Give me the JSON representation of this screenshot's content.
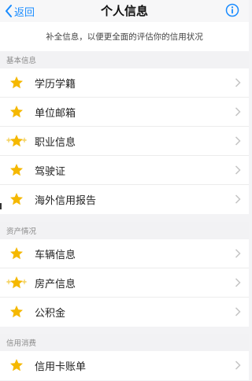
{
  "nav": {
    "back_label": "返回",
    "title": "个人信息",
    "info_icon": "info-circle-icon"
  },
  "notice": "补全信息，以便更全面的评估你的信用状况",
  "sections": [
    {
      "header": "基本信息",
      "items": [
        {
          "label": "学历学籍",
          "icon": "star-icon"
        },
        {
          "label": "单位邮箱",
          "icon": "star-icon"
        },
        {
          "label": "职业信息",
          "icon": "star-sparkle-icon"
        },
        {
          "label": "驾驶证",
          "icon": "star-icon"
        },
        {
          "label": "海外信用报告",
          "icon": "star-icon"
        }
      ]
    },
    {
      "header": "资产情况",
      "items": [
        {
          "label": "车辆信息",
          "icon": "star-icon"
        },
        {
          "label": "房产信息",
          "icon": "star-sparkle-icon"
        },
        {
          "label": "公积金",
          "icon": "star-icon"
        }
      ]
    },
    {
      "header": "信用消费",
      "items": [
        {
          "label": "信用卡账单",
          "icon": "star-icon"
        }
      ]
    }
  ],
  "colors": {
    "accent": "#1a8cff",
    "star": "#f5b800",
    "background": "#f3f3f5",
    "chevron": "#c4c4c4"
  }
}
